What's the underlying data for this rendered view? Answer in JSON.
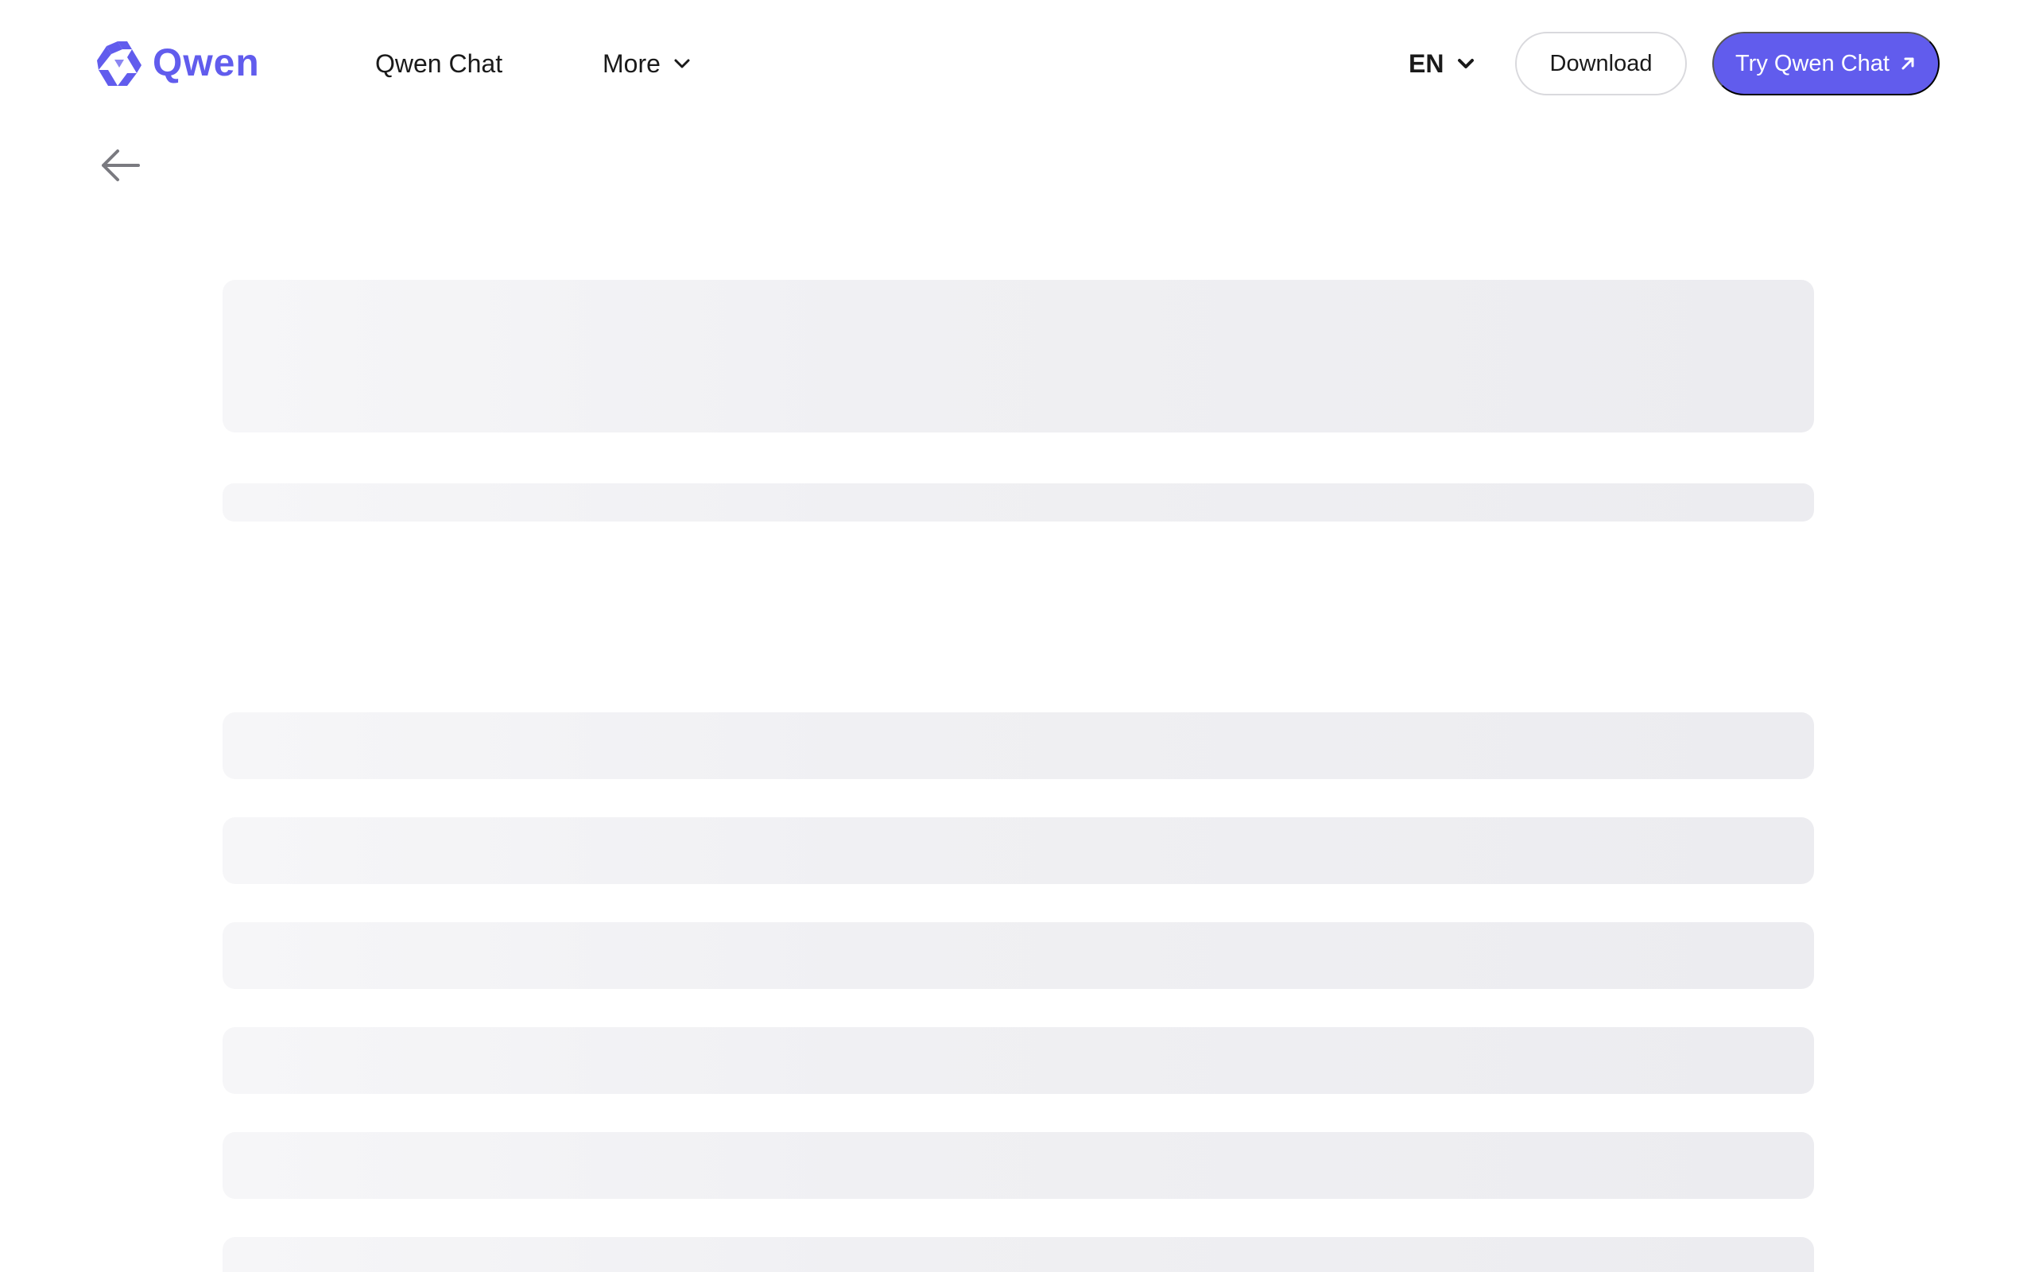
{
  "header": {
    "logo_text": "Qwen",
    "logo_icon": "qwen-logo-icon",
    "nav": {
      "qwen_chat": "Qwen Chat",
      "more": "More"
    },
    "language": "EN",
    "download_label": "Download",
    "try_label": "Try Qwen Chat"
  },
  "icons": {
    "back": "arrow-left-icon",
    "more_chevron": "chevron-down-icon",
    "lang_chevron": "chevron-down-icon",
    "try_arrow": "arrow-up-right-icon"
  },
  "colors": {
    "brand": "#615ced",
    "skeleton": "#f0f0f3",
    "border": "#d9d9dd"
  },
  "loading_state": "skeleton placeholders"
}
